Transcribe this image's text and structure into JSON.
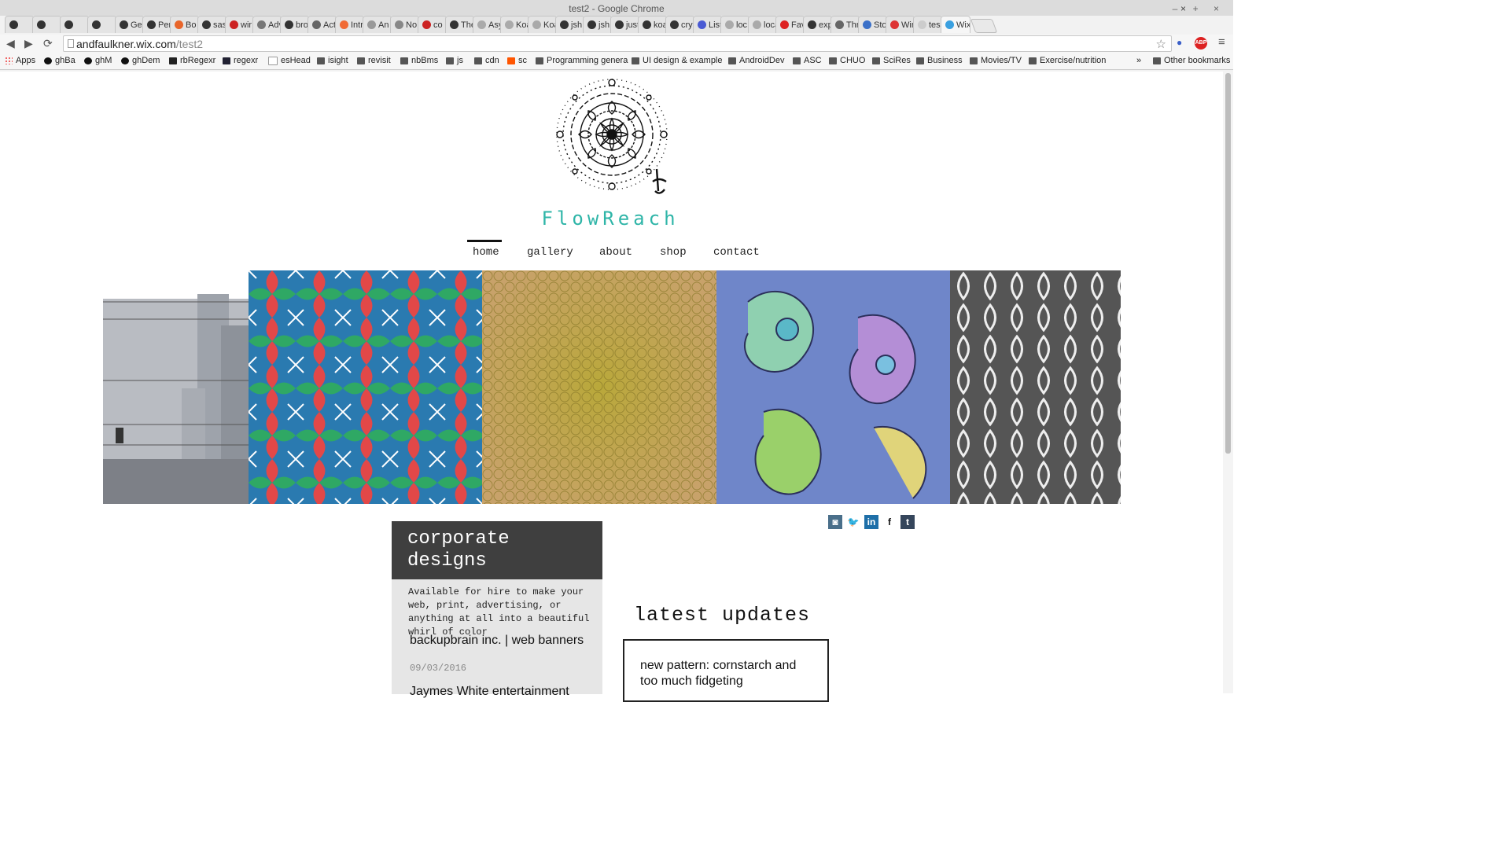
{
  "window": {
    "title": "test2 - Google Chrome",
    "controls": "– + ×"
  },
  "tabs": [
    {
      "label": ""
    },
    {
      "label": ""
    },
    {
      "label": ""
    },
    {
      "label": ""
    },
    {
      "label": "Ge"
    },
    {
      "label": "Per"
    },
    {
      "label": "Bo"
    },
    {
      "label": "sas"
    },
    {
      "label": "wir"
    },
    {
      "label": "Adv"
    },
    {
      "label": "bro"
    },
    {
      "label": "Act"
    },
    {
      "label": "Intr"
    },
    {
      "label": "An"
    },
    {
      "label": "No"
    },
    {
      "label": "co"
    },
    {
      "label": "The"
    },
    {
      "label": "Asy"
    },
    {
      "label": "Koa"
    },
    {
      "label": "Koa"
    },
    {
      "label": "jsh"
    },
    {
      "label": "jsh"
    },
    {
      "label": "just"
    },
    {
      "label": "koa"
    },
    {
      "label": "cry"
    },
    {
      "label": "List"
    },
    {
      "label": "loc"
    },
    {
      "label": "loca"
    },
    {
      "label": "Fav"
    },
    {
      "label": "exp"
    },
    {
      "label": "Thr"
    },
    {
      "label": "Sto"
    },
    {
      "label": "Wir"
    },
    {
      "label": "tes"
    },
    {
      "label": "Wix"
    }
  ],
  "tab_close": "×",
  "address": {
    "host": "andfaulkner.wix.com",
    "path": "/test2"
  },
  "toolbar": {
    "back": "◀",
    "forward": "▶",
    "reload": "⟳",
    "star": "☆",
    "abp": "ABP",
    "menu": "≡"
  },
  "bookmarks": [
    "Apps",
    "ghBa",
    "ghM",
    "ghDem",
    "rbRegexr",
    "regexr",
    "esHead",
    "isight",
    "revisit",
    "nbBms",
    "js",
    "cdn",
    "sc",
    "Programming genera",
    "UI design & example",
    "AndroidDev",
    "ASC",
    "CHUO",
    "SciRes",
    "Business",
    "Movies/TV",
    "Exercise/nutrition",
    "»",
    "Other bookmarks"
  ],
  "site": {
    "brand": "FlowReach",
    "nav": [
      "home",
      "gallery",
      "about",
      "shop",
      "contact"
    ],
    "social": [
      "instagram",
      "twitter",
      "linkedin",
      "facebook",
      "tumblr"
    ],
    "social_glyphs": [
      "◙",
      "🐦",
      "in",
      "f",
      "t"
    ],
    "corporate": {
      "title": "corporate designs",
      "description": "Available for hire to make your web, print, advertising, or anything at all into a beautiful whirl of color",
      "project_title": "backupbrain inc. | web banners",
      "project_date": "09/03/2016",
      "project2_title": "Jaymes White entertainment"
    },
    "latest": {
      "title": "latest updates",
      "item": "new pattern: cornstarch and too much fidgeting"
    }
  },
  "colors": {
    "brand": "#2fb5a8",
    "corp_header": "#3f3f3f",
    "corp_bg": "#e6e6e6"
  }
}
